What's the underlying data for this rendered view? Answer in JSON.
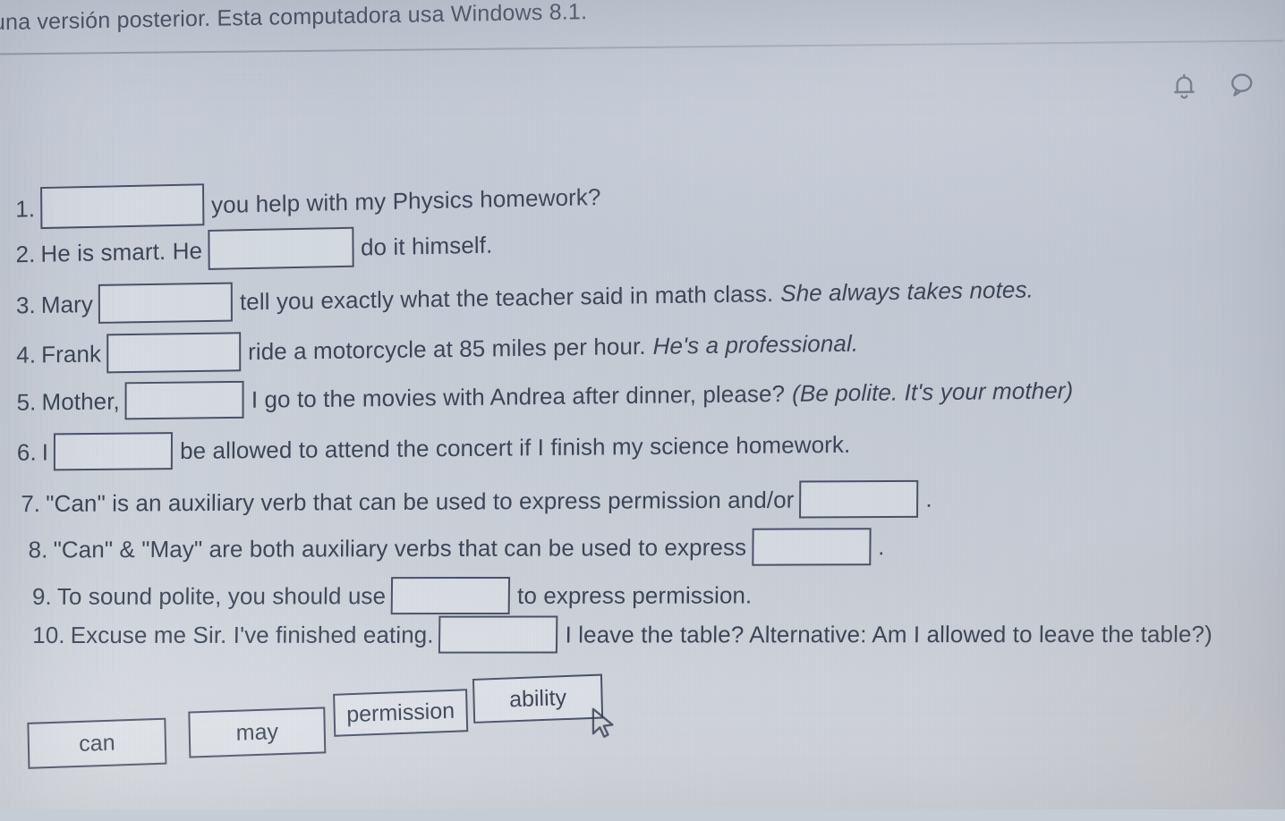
{
  "banner": {
    "text": "una versión posterior. Esta computadora usa Windows 8.1."
  },
  "header": {
    "icons": [
      {
        "name": "bell-icon",
        "label": "Notifications"
      },
      {
        "name": "chat-bubble-icon",
        "label": "Messages"
      }
    ]
  },
  "colors": {
    "background": "#c6ccd6",
    "text": "#3c4659",
    "box_border": "#4a5268"
  },
  "questions": [
    {
      "number": "1.",
      "pre": "",
      "post": "you help with my Physics homework?",
      "post_italic": ""
    },
    {
      "number": "2.",
      "pre": "He is smart. He",
      "post": "do it himself.",
      "post_italic": ""
    },
    {
      "number": "3.",
      "pre": "Mary",
      "post": "tell you exactly what the teacher said in math class.",
      "post_italic": "She always takes notes."
    },
    {
      "number": "4.",
      "pre": "Frank",
      "post": "ride a motorcycle at 85 miles per hour.",
      "post_italic": "He's a professional."
    },
    {
      "number": "5.",
      "pre": "Mother,",
      "post": "I go to the movies with Andrea after dinner, please?",
      "post_italic": "(Be polite. It's your mother)"
    },
    {
      "number": "6.",
      "pre": "I",
      "post": "be allowed to attend the concert if I finish my science homework.",
      "post_italic": ""
    },
    {
      "number": "7.",
      "pre": "\"Can\" is an auxiliary verb that can be used to express permission and/or",
      "post": ".",
      "post_italic": ""
    },
    {
      "number": "8.",
      "pre": "\"Can\" & \"May\" are both auxiliary verbs that can be used to express",
      "post": ".",
      "post_italic": ""
    },
    {
      "number": "9.",
      "pre": "To sound polite, you should use",
      "post": "to express permission.",
      "post_italic": ""
    },
    {
      "number": "10.",
      "pre": "Excuse me Sir. I've finished eating.",
      "post": "I leave the table? Alternative: Am I allowed to leave the table?)",
      "post_italic": ""
    }
  ],
  "answer_chips": [
    {
      "label": "can"
    },
    {
      "label": "may"
    },
    {
      "label": "permission"
    },
    {
      "label": "ability"
    }
  ],
  "cursor": {
    "name": "mouse-pointer"
  }
}
